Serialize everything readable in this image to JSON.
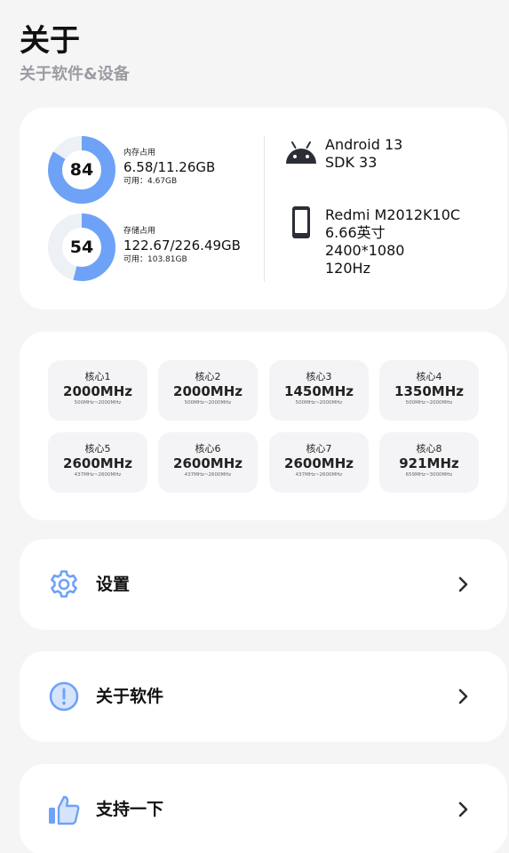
{
  "header": {
    "title": "关于",
    "subtitle": "关于软件&设备"
  },
  "memory": {
    "percent": 84,
    "percent_label": "84",
    "label": "内存占用",
    "value": "6.58/11.26GB",
    "available": "可用：4.67GB"
  },
  "storage": {
    "percent": 54,
    "percent_label": "54",
    "label": "存储占用",
    "value": "122.67/226.49GB",
    "available": "可用：103.81GB"
  },
  "system": {
    "android": "Android 13",
    "sdk": "SDK 33"
  },
  "device": {
    "model": "Redmi M2012K10C",
    "screen_size": "6.66英寸",
    "resolution": "2400*1080",
    "refresh_rate": "120Hz"
  },
  "cores": [
    {
      "name": "核心1",
      "freq": "2000MHz",
      "range": "500MHz~2000MHz"
    },
    {
      "name": "核心2",
      "freq": "2000MHz",
      "range": "500MHz~2000MHz"
    },
    {
      "name": "核心3",
      "freq": "1450MHz",
      "range": "500MHz~2000MHz"
    },
    {
      "name": "核心4",
      "freq": "1350MHz",
      "range": "500MHz~2000MHz"
    },
    {
      "name": "核心5",
      "freq": "2600MHz",
      "range": "437MHz~2600MHz"
    },
    {
      "name": "核心6",
      "freq": "2600MHz",
      "range": "437MHz~2600MHz"
    },
    {
      "name": "核心7",
      "freq": "2600MHz",
      "range": "437MHz~2600MHz"
    },
    {
      "name": "核心8",
      "freq": "921MHz",
      "range": "659MHz~3000MHz"
    }
  ],
  "menu": {
    "settings": "设置",
    "about": "关于软件",
    "support": "支持一下"
  },
  "icons": {
    "settings": "gear-icon",
    "about": "info-icon",
    "support": "thumbs-up-icon",
    "android": "android-icon",
    "device": "phone-icon",
    "chevron": "chevron-right-icon"
  },
  "colors": {
    "accent": "#6ea2f7",
    "track": "#edf0f5",
    "background": "#f5f5f6",
    "card": "#ffffff"
  }
}
